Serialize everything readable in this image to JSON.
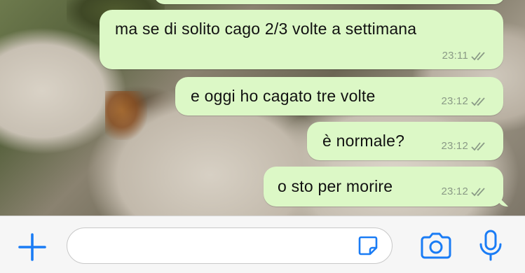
{
  "chat": {
    "messages": [
      {
        "text": "ma se di solito cago 2/3 volte a settimana",
        "time": "23:11",
        "status": "read"
      },
      {
        "text": "e oggi ho cagato tre volte",
        "time": "23:12",
        "status": "read"
      },
      {
        "text": "è normale?",
        "time": "23:12",
        "status": "read"
      },
      {
        "text": "o sto per morire",
        "time": "23:12",
        "status": "read"
      }
    ]
  },
  "composer": {
    "value": "",
    "icons": {
      "attach": "plus-icon",
      "sticker": "sticker-icon",
      "camera": "camera-icon",
      "mic": "microphone-icon"
    }
  },
  "colors": {
    "outgoing_bubble": "#dcf8c6",
    "accent": "#1a7cf5",
    "ticks": "#8a9a86"
  }
}
